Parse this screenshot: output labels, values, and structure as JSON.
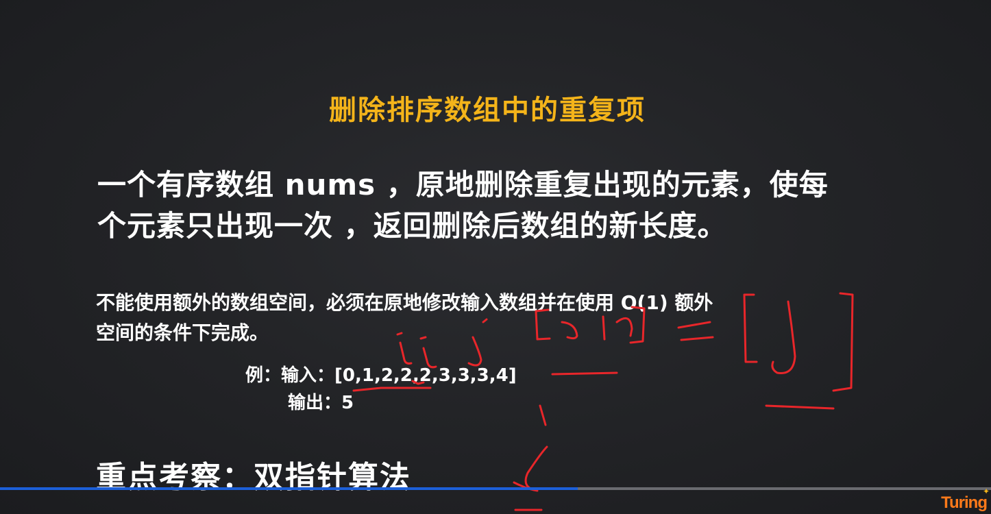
{
  "slide": {
    "title": "删除排序数组中的重复项",
    "description_line1": "一个有序数组 nums ，原地删除重复出现的元素，使每",
    "description_line2": "个元素只出现一次 ，返回删除后数组的新长度。",
    "note_line1": "不能使用额外的数组空间，必须在原地修改输入数组并在使用 O(1) 额外",
    "note_line2": "空间的条件下完成。",
    "example_input_label": "例：输入：",
    "example_input_value": "[0,1,2,2,2,3,3,3,4]",
    "example_output_label": "输出：",
    "example_output_value": "5",
    "focus": "重点考察：双指针算法"
  },
  "player": {
    "progress": 0.583,
    "progress_color": "#1c5fd8",
    "logo_text": "Turing"
  },
  "colors": {
    "title": "#f4b41a",
    "annotation": "#e8262a",
    "background": "#232427"
  }
}
